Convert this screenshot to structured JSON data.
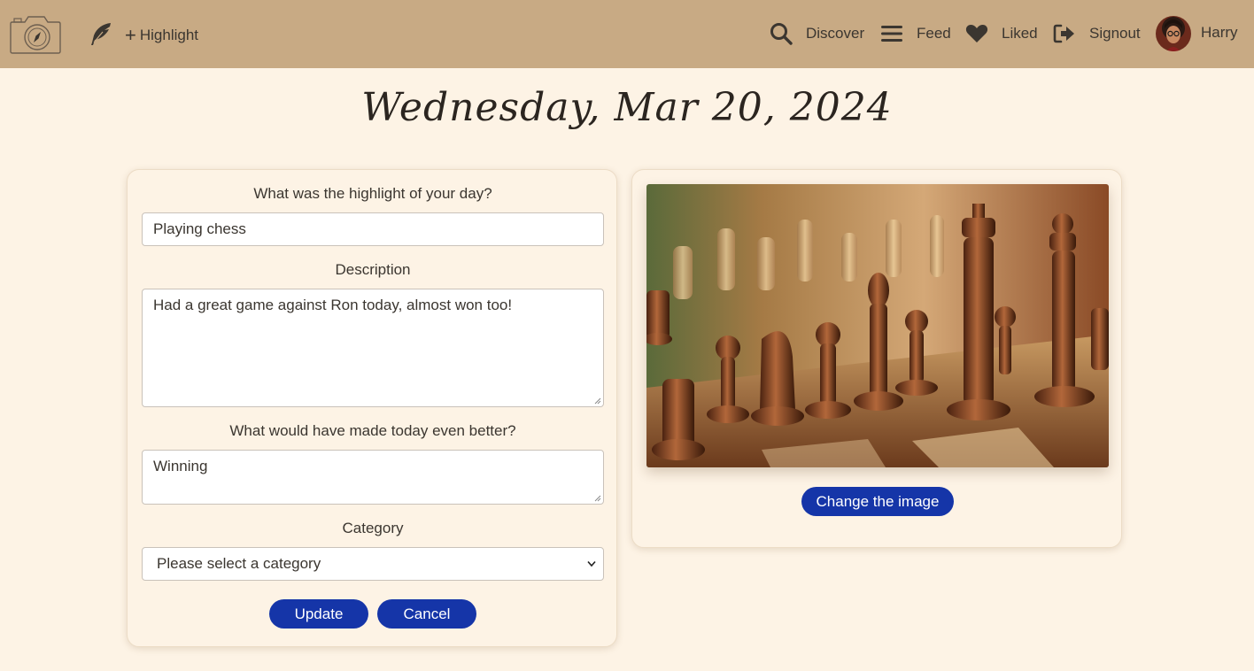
{
  "nav": {
    "logo_icon": "camera-compass-logo",
    "highlight_icon": "feather-icon",
    "highlight_label": "Highlight",
    "plus_symbol": "+",
    "discover_label": "Discover",
    "feed_label": "Feed",
    "liked_label": "Liked",
    "signout_label": "Signout",
    "user_name": "Harry"
  },
  "page": {
    "date": "Wednesday, Mar 20, 2024"
  },
  "form": {
    "highlight_question": "What was the highlight of your day?",
    "highlight_value": "Playing chess",
    "description_label": "Description",
    "description_value": "Had a great game against Ron today, almost won too!",
    "better_question": "What would have made today even better?",
    "better_value": "Winning",
    "category_label": "Category",
    "category_selected": "Please select a category",
    "update_label": "Update",
    "cancel_label": "Cancel"
  },
  "image_panel": {
    "change_image_label": "Change the image"
  },
  "colors": {
    "navbar": "#c8aa84",
    "background": "#fdf3e5",
    "button": "#1535a8"
  }
}
